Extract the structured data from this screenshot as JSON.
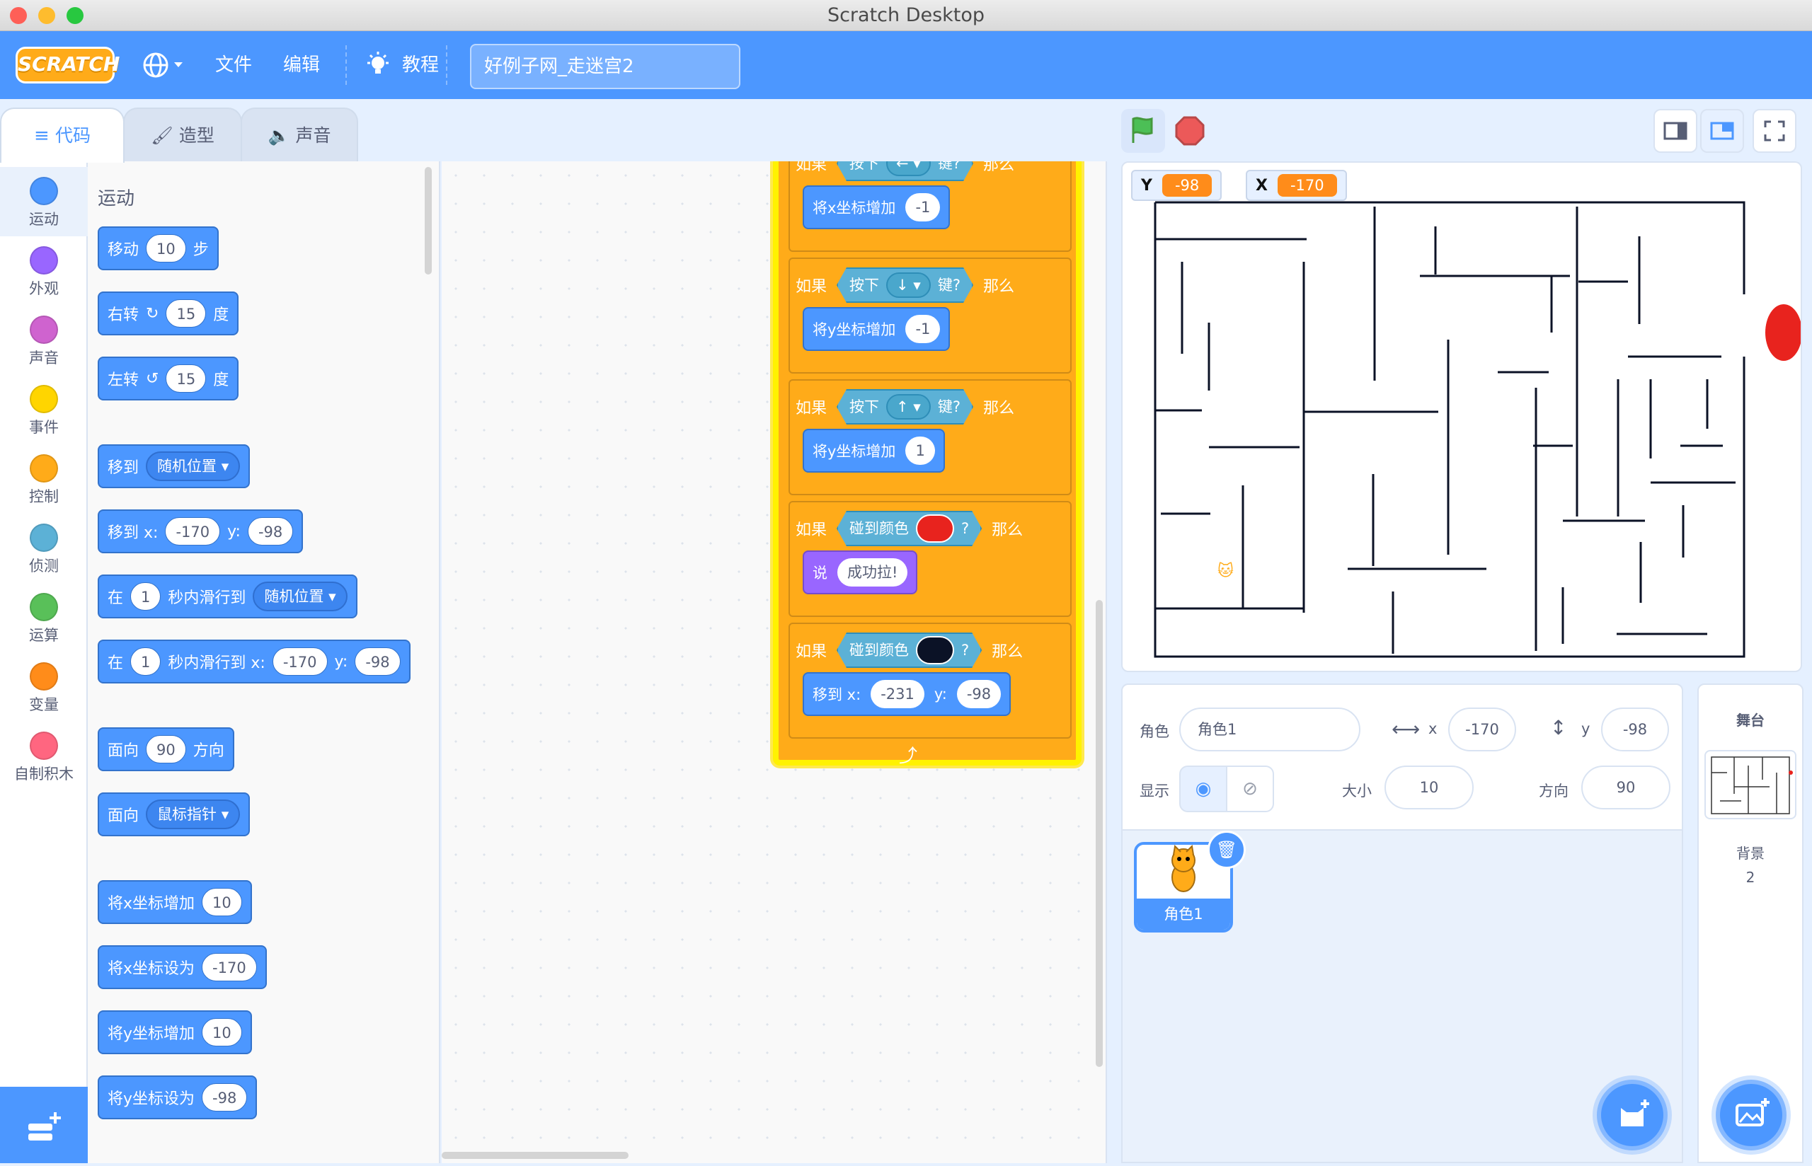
{
  "window": {
    "title": "Scratch Desktop"
  },
  "menu": {
    "logo": "SCRATCH",
    "file": "文件",
    "edit": "编辑",
    "tutorials": "教程",
    "project_title": "好例子网_走迷宫2"
  },
  "tabs": {
    "code": "代码",
    "costumes": "造型",
    "sounds": "声音"
  },
  "categories": [
    {
      "label": "运动",
      "color": "#4c97ff"
    },
    {
      "label": "外观",
      "color": "#9966ff"
    },
    {
      "label": "声音",
      "color": "#cf63cf"
    },
    {
      "label": "事件",
      "color": "#ffd500"
    },
    {
      "label": "控制",
      "color": "#ffab19"
    },
    {
      "label": "侦测",
      "color": "#5cb1d6"
    },
    {
      "label": "运算",
      "color": "#59c059"
    },
    {
      "label": "变量",
      "color": "#ff8c1a"
    },
    {
      "label": "自制积木",
      "color": "#ff6680"
    }
  ],
  "palette": {
    "section": "运动",
    "move": {
      "a": "移动",
      "v": "10",
      "b": "步"
    },
    "turn_right": {
      "a": "右转",
      "v": "15",
      "b": "度"
    },
    "turn_left": {
      "a": "左转",
      "v": "15",
      "b": "度"
    },
    "goto": {
      "a": "移到",
      "dd": "随机位置"
    },
    "goto_xy": {
      "a": "移到 x:",
      "x": "-170",
      "yl": "y:",
      "y": "-98"
    },
    "glide_to": {
      "a": "在",
      "v": "1",
      "b": "秒内滑行到",
      "dd": "随机位置"
    },
    "glide_xy": {
      "a": "在",
      "v": "1",
      "b": "秒内滑行到 x:",
      "x": "-170",
      "yl": "y:",
      "y": "-98"
    },
    "point_dir": {
      "a": "面向",
      "v": "90",
      "b": "方向"
    },
    "point_towards": {
      "a": "面向",
      "dd": "鼠标指针"
    },
    "change_x": {
      "a": "将x坐标增加",
      "v": "10"
    },
    "set_x": {
      "a": "将x坐标设为",
      "v": "-170"
    },
    "change_y": {
      "a": "将y坐标增加",
      "v": "10"
    },
    "set_y": {
      "a": "将y坐标设为",
      "v": "-98"
    }
  },
  "script": {
    "if": "如果",
    "then": "那么",
    "press": "按下",
    "key": "键?",
    "touch_color": "碰到颜色",
    "q": "?",
    "b1": {
      "keyname": "←",
      "action": "将x坐标增加",
      "v": "-1"
    },
    "b2": {
      "keyname": "↓",
      "action": "将y坐标增加",
      "v": "-1"
    },
    "b3": {
      "keyname": "↑",
      "action": "将y坐标增加",
      "v": "1"
    },
    "b4": {
      "color": "#e8231e",
      "action": "说",
      "v": "成功拉!"
    },
    "b5": {
      "color": "#0b1226",
      "action": "移到 x:",
      "x": "-231",
      "yl": "y:",
      "y": "-98"
    }
  },
  "zoom": {
    "in": "⊕",
    "out": "⊖",
    "reset": "="
  },
  "monitors": {
    "y_label": "Y",
    "y_value": "-98",
    "x_label": "X",
    "x_value": "-170"
  },
  "sprite_info": {
    "sprite_label": "角色",
    "sprite_name": "角色1",
    "x_label": "x",
    "x": "-170",
    "y_label": "y",
    "y": "-98",
    "show_label": "显示",
    "size_label": "大小",
    "size": "10",
    "direction_label": "方向",
    "direction": "90"
  },
  "sprites": [
    {
      "name": "角色1"
    }
  ],
  "stage_panel": {
    "title": "舞台",
    "backdrop_label": "背景",
    "backdrop_count": "2"
  }
}
